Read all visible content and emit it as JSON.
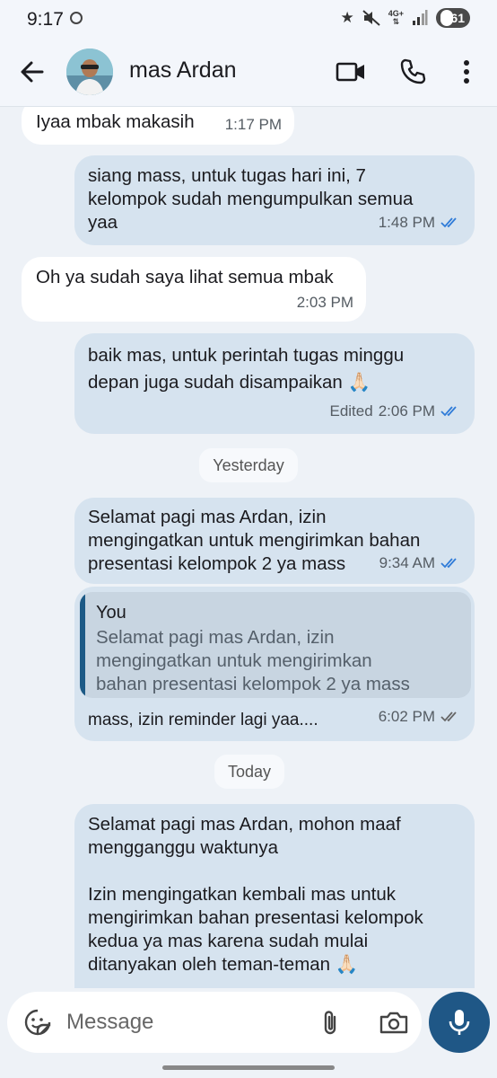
{
  "status_bar": {
    "time": "9:17",
    "network": "4G+",
    "battery": "61"
  },
  "header": {
    "contact_name": "mas Ardan"
  },
  "messages": [
    {
      "text": "Iyaa mbak makasih",
      "time": "1:17 PM"
    },
    {
      "text": "siang mass, untuk tugas hari ini, 7\nkelompok sudah mengumpulkan semua\nyaa",
      "time": "1:48 PM"
    },
    {
      "text": "Oh ya sudah saya lihat semua mbak",
      "time": "2:03 PM"
    },
    {
      "text": "baik mas, untuk perintah tugas minggu\ndepan juga sudah disampaikan 🙏🏻",
      "edited": "Edited",
      "time": "2:06 PM"
    },
    {
      "text": "Selamat pagi mas Ardan, izin\nmengingatkan untuk mengirimkan bahan\npresentasi kelompok 2 ya mass",
      "time": "9:34 AM"
    },
    {
      "quote_author": "You",
      "quote_text": "Selamat pagi mas Ardan, izin\nmengingatkan untuk mengirimkan\nbahan presentasi kelompok 2 ya mass",
      "text": "mass, izin reminder lagi yaa....",
      "time": "6:02 PM"
    },
    {
      "text": "Selamat pagi mas Ardan, mohon maaf\nmengganggu waktunya\n\nIzin mengingatkan kembali mas untuk\nmengirimkan bahan presentasi kelompok\nkedua ya mas karena sudah mulai\nditanyakan oleh teman-teman 🙏🏻"
    }
  ],
  "date_separators": {
    "yesterday": "Yesterday",
    "today": "Today"
  },
  "input": {
    "placeholder": "Message"
  },
  "colors": {
    "outgoing_bubble": "#d6e3ef",
    "incoming_bubble": "#ffffff",
    "accent": "#1f5786",
    "read_ticks": "#2f7bd8",
    "sent_ticks": "#666666"
  },
  "icons": {
    "back": "arrow-left-icon",
    "video": "video-camera-icon",
    "call": "phone-icon",
    "more": "more-vertical-icon",
    "emoji": "sticker-icon",
    "attach": "paperclip-icon",
    "camera": "camera-icon",
    "mic": "microphone-icon"
  }
}
